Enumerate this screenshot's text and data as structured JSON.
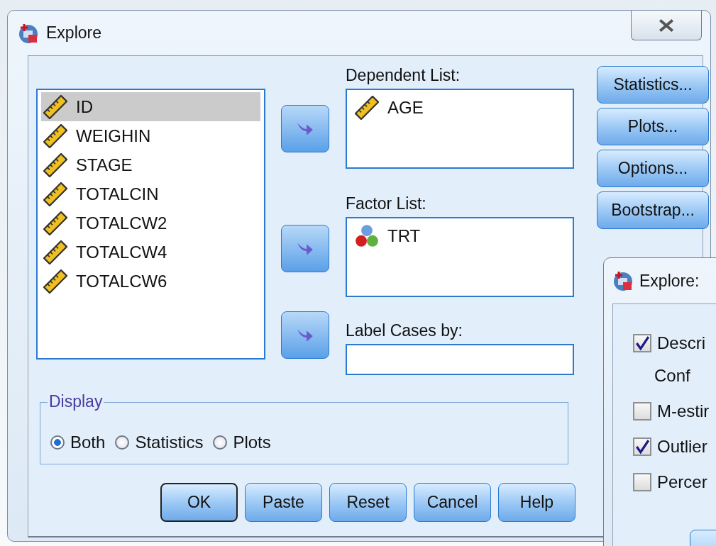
{
  "window": {
    "title": "Explore"
  },
  "variables": [
    {
      "name": "ID",
      "kind": "scale",
      "selected": true
    },
    {
      "name": "WEIGHIN",
      "kind": "scale",
      "selected": false
    },
    {
      "name": "STAGE",
      "kind": "scale",
      "selected": false
    },
    {
      "name": "TOTALCIN",
      "kind": "scale",
      "selected": false
    },
    {
      "name": "TOTALCW2",
      "kind": "scale",
      "selected": false
    },
    {
      "name": "TOTALCW4",
      "kind": "scale",
      "selected": false
    },
    {
      "name": "TOTALCW6",
      "kind": "scale",
      "selected": false
    }
  ],
  "dependent_list": {
    "label": "Dependent List:",
    "items": [
      {
        "name": "AGE",
        "kind": "scale"
      }
    ]
  },
  "factor_list": {
    "label": "Factor List:",
    "items": [
      {
        "name": "TRT",
        "kind": "nominal"
      }
    ]
  },
  "label_cases": {
    "label": "Label Cases by:"
  },
  "side_buttons": [
    "Statistics...",
    "Plots...",
    "Options...",
    "Bootstrap..."
  ],
  "display": {
    "label": "Display",
    "options": [
      {
        "label": "Both",
        "selected": true
      },
      {
        "label": "Statistics",
        "selected": false
      },
      {
        "label": "Plots",
        "selected": false
      }
    ]
  },
  "buttons": [
    {
      "label": "OK",
      "default": true
    },
    {
      "label": "Paste",
      "default": false
    },
    {
      "label": "Reset",
      "default": false
    },
    {
      "label": "Cancel",
      "default": false
    },
    {
      "label": "Help",
      "default": false
    }
  ],
  "sub_dialog": {
    "title": "Explore:",
    "options": [
      {
        "kind": "checkbox",
        "label": "Descri",
        "checked": true
      },
      {
        "kind": "text",
        "label": "Conf"
      },
      {
        "kind": "checkbox",
        "label": "M-estir",
        "checked": false
      },
      {
        "kind": "checkbox",
        "label": "Outlier",
        "checked": true
      },
      {
        "kind": "checkbox",
        "label": "Percer",
        "checked": false
      }
    ]
  }
}
